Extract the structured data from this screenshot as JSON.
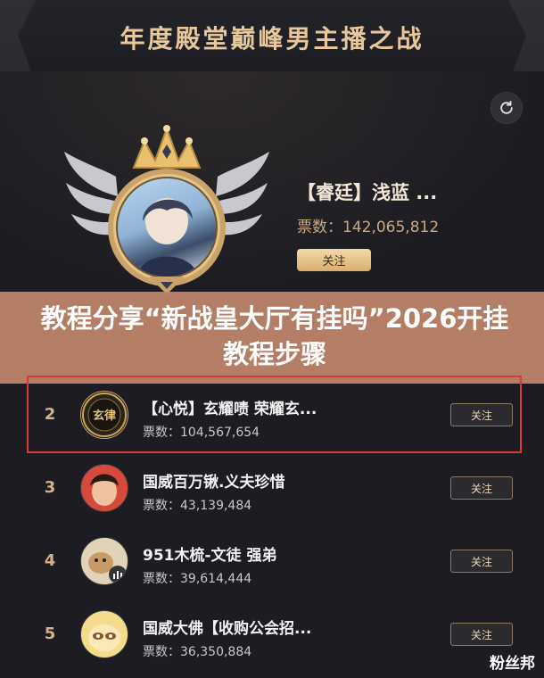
{
  "header": {
    "title": "年度殿堂巅峰男主播之战"
  },
  "top": {
    "refresh_icon": "refresh-icon",
    "winner": {
      "name": "【睿廷】浅蓝 ...",
      "votes": "票数：142,065,812",
      "follow_label": "关注"
    }
  },
  "banner": {
    "text": "教程分享“新战皇大厅有挂吗”2026开挂教程步骤"
  },
  "list": [
    {
      "rank": "2",
      "name": "【心悦】玄耀啧 荣耀玄...",
      "votes": "票数：104,567,654",
      "follow_label": "关注",
      "avatar_label": "玄律",
      "highlighted": true
    },
    {
      "rank": "3",
      "name": "国威百万锹.义夫珍惜",
      "votes": "票数：43,139,484",
      "follow_label": "关注"
    },
    {
      "rank": "4",
      "name": "951木梳-文徒 强弟",
      "votes": "票数：39,614,444",
      "follow_label": "关注"
    },
    {
      "rank": "5",
      "name": "国威大佛【收购公会招...",
      "votes": "票数：36,350,884",
      "follow_label": "关注"
    }
  ],
  "watermark": "粉丝邦",
  "colors": {
    "gold": "#e8c79a",
    "banner": "#be846c",
    "highlight": "#d63b3b",
    "background": "#1c1c22"
  }
}
